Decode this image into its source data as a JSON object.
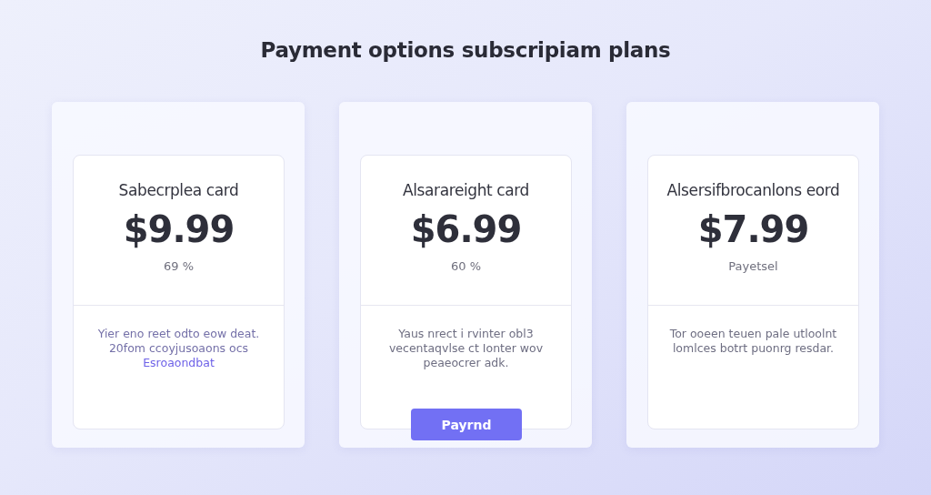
{
  "title": "Payment options subscripiam plans",
  "plans": [
    {
      "name": "Sabecrplea card",
      "price": "$9.99",
      "note": "69 %",
      "description": {
        "text": "Yier eno reet odto eow deat. 20fom ccoyjusoaons ocs",
        "link": "Esroaondbat"
      }
    },
    {
      "name": "Alsarareight card",
      "price": "$6.99",
      "note": "60 %",
      "description": {
        "text": "Yaus nrect i rvinter obl3 vecentaqvlse ct Ionter wov peaeocrer adk."
      },
      "button": "Payrnd"
    },
    {
      "name": "Alsersifbrocanlons eord",
      "price": "$7.99",
      "note": "Payetsel",
      "description": {
        "text": "Tor ooeen teuen pale utloolnt lomlces botrt puonrg resdar."
      }
    }
  ]
}
